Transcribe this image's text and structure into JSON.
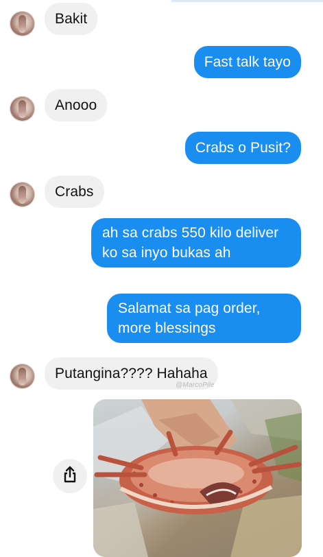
{
  "chat": {
    "messages": [
      {
        "sender": "contact",
        "text": "Bakit"
      },
      {
        "sender": "me",
        "text": "Fast talk tayo"
      },
      {
        "sender": "contact",
        "text": "Anooo"
      },
      {
        "sender": "me",
        "text": "Crabs o Pusit?"
      },
      {
        "sender": "contact",
        "text": "Crabs"
      },
      {
        "sender": "me",
        "text": "ah sa crabs 550 kilo deliver ko sa inyo bukas ah"
      },
      {
        "sender": "me",
        "text": "Salamat sa pag order, more blessings"
      },
      {
        "sender": "contact",
        "text": "Putangina???? Hahaha"
      }
    ],
    "watermark": "@MarcoPile",
    "share_icon": "share-icon",
    "photo": {
      "description": "hand-holding-crab-photo"
    }
  },
  "colors": {
    "sent_bubble": "#1a8df1",
    "received_bubble": "#f0f0f0",
    "sent_text": "#ffffff",
    "received_text": "#111111"
  }
}
